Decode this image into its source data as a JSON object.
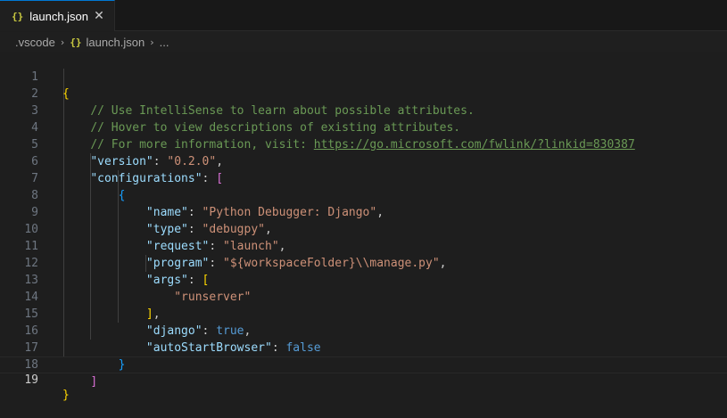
{
  "tab": {
    "icon_text": "{}",
    "label": "launch.json",
    "close_glyph": "✕"
  },
  "breadcrumb": {
    "folder": ".vscode",
    "file": "launch.json",
    "more": "...",
    "separator": "›"
  },
  "editor": {
    "line_numbers": [
      "1",
      "2",
      "3",
      "4",
      "5",
      "6",
      "7",
      "8",
      "9",
      "10",
      "11",
      "12",
      "13",
      "14",
      "15",
      "16",
      "17",
      "18",
      "19"
    ],
    "current_line": 19,
    "comments": {
      "line2": "// Use IntelliSense to learn about possible attributes.",
      "line3": "// Hover to view descriptions of existing attributes.",
      "line4_prefix": "// For more information, visit: ",
      "line4_url": "https://go.microsoft.com/fwlink/?linkid=830387"
    },
    "keys": {
      "version": "\"version\"",
      "configurations": "\"configurations\"",
      "name": "\"name\"",
      "type": "\"type\"",
      "request": "\"request\"",
      "program": "\"program\"",
      "args": "\"args\"",
      "django": "\"django\"",
      "autoStartBrowser": "\"autoStartBrowser\""
    },
    "values": {
      "version": "\"0.2.0\"",
      "name": "\"Python Debugger: Django\"",
      "type": "\"debugpy\"",
      "request": "\"launch\"",
      "program": "\"${workspaceFolder}\\\\manage.py\"",
      "arg0": "\"runserver\"",
      "django": "true",
      "autoStartBrowser": "false"
    }
  }
}
